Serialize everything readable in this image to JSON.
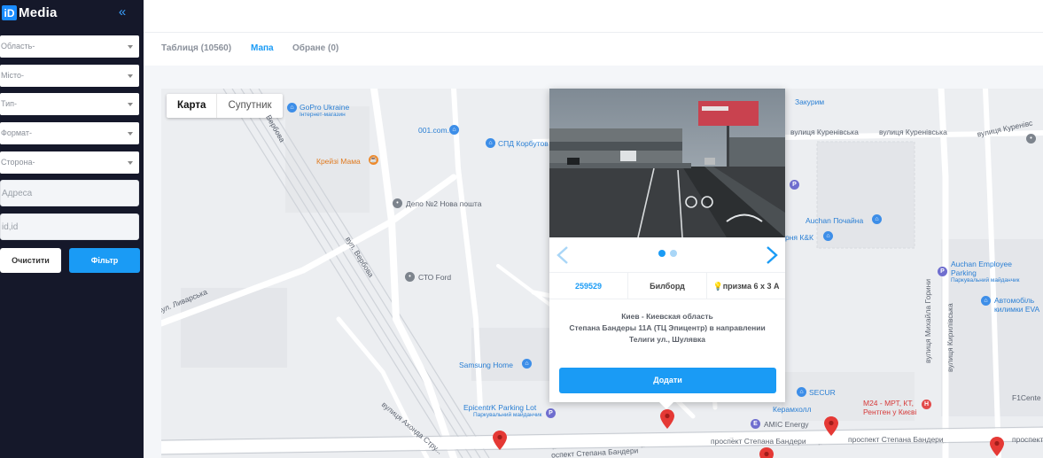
{
  "brand": {
    "logo_mark": "iD",
    "name": "Media",
    "collapse_icon": "«"
  },
  "filters": {
    "region": "Область-",
    "city": "Місто-",
    "type": "Тип-",
    "format": "Формат-",
    "side": "Сторона-",
    "address_placeholder": "Адреса",
    "ids_placeholder": "id,id",
    "clear_label": "Очистити",
    "filter_label": "Фільтр"
  },
  "tabs": [
    {
      "label": "Таблиця (10560)",
      "active": false
    },
    {
      "label": "Мапа",
      "active": true
    },
    {
      "label": "Обране (0)",
      "active": false
    }
  ],
  "map": {
    "type_buttons": [
      "Карта",
      "Супутник"
    ],
    "labels": {
      "gopro": "GoPro Ukraine",
      "gopro_sub": "Інтернет-магазин",
      "domain": "001.com.ua",
      "spd": "СПД Корбутов",
      "kreizi": "Крейзі Мама",
      "depo": "Депо №2 Нова пошта",
      "verbova1": "Вербова",
      "verbova2": "вул. Вербова",
      "sto": "СТО Ford",
      "lyvarska": "вул. Ливарська",
      "samsung": "Samsung Home",
      "epicentr": "EpicentrK Parking Lot",
      "epicentr_sub": "Паркувальний майданчик",
      "akhonda": "вулиця Ахонда Стру...",
      "bandery1": "проспект Степана Бандери",
      "bandery2": "проспект Степана Бандери",
      "bandery3": "проспект Степана Бандери",
      "bandery4": "проспект Степана Бандери",
      "bandery5": "проспект Ст",
      "bandery6": "оспект Степана Бандери",
      "zakurym": "Закурим",
      "kurenivska1": "вулиця Куренівська",
      "kurenivska2": "вулиця Куренівська",
      "kurenivska3": "вулиця Куренівська",
      "kurenivska4": "вулиця Куренівс",
      "kurenivska5": "вулиця",
      "auchan": "Auchan Почайна",
      "kk": "рня К&К",
      "auchan_emp": "Auchan Employee",
      "auchan_emp2": "Parking",
      "auchan_emp_sub": "Паркувальний майданчик",
      "avtomob": "Автомобіль",
      "kilimky": "килимки EVA",
      "horyna": "вулиця Михайла Горини",
      "secur": "SECUR",
      "keramkholl": "Керамхолл",
      "amic": "AMIC Energy",
      "m24": "M24 - МРТ, КТ,",
      "m24b": "Рентген у Києві",
      "f1": "F1Cente",
      "kirilivska": "вулиця Кирилівська"
    }
  },
  "popup": {
    "id": "259529",
    "kind": "Билборд",
    "size": "призма 6 х 3 А",
    "address_line1": "Киев - Киевская область",
    "address_line2": "Степана Бандеры 11А (ТЦ Эпицентр) в направлении",
    "address_line3": "Телиги ул., Шулявка",
    "add_label": "Додати"
  }
}
